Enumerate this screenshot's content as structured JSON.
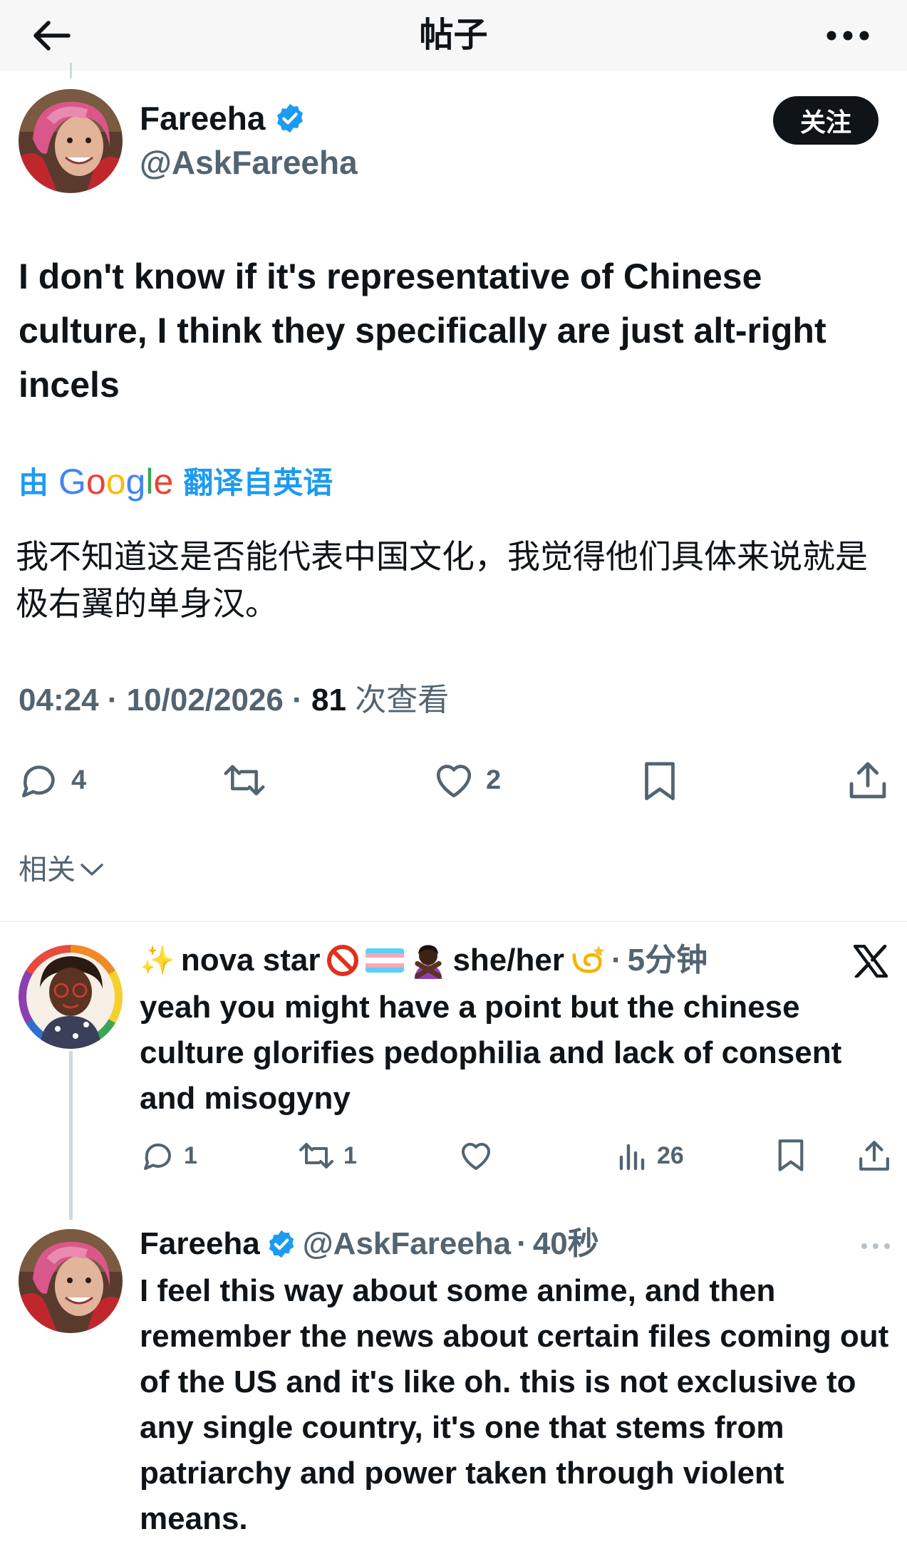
{
  "header": {
    "title": "帖子",
    "back_icon": "arrow-left-icon",
    "more_icon": "more-horizontal-icon"
  },
  "post": {
    "author_name": "Fareeha",
    "handle": "@AskFareeha",
    "follow_label": "关注",
    "text": "I don't know if it's representative of Chinese culture, I think they specifically are just alt-right incels",
    "translate_prefix": "由",
    "translate_brand": "Google",
    "translate_suffix": "翻译自英语",
    "translated_text": "我不知道这是否能代表中国文化，我觉得他们具体来说就是极右翼的单身汉。",
    "time": "04:24",
    "date": "10/02/2026",
    "views_count": "81",
    "views_label": "次查看",
    "separator": "·",
    "stats": {
      "replies": "4",
      "retweets": "",
      "likes": "2"
    }
  },
  "related_label": "相关",
  "replies": [
    {
      "author_name": "nova star",
      "pronouns": "she/her",
      "time": "5分钟",
      "text": "yeah you might have a point but the chinese culture glorifies pedophilia and lack of consent and misogyny",
      "stats": {
        "replies": "1",
        "retweets": "1",
        "likes": "",
        "views": "26"
      }
    },
    {
      "author_name": "Fareeha",
      "handle": "@AskFareeha",
      "time": "40秒",
      "text": "I feel this way about some anime, and then remember the news about certain files coming out of the US and it's like oh. this is not exclusive to any single country, it's one that stems from patriarchy and power taken through violent means."
    }
  ],
  "colors": {
    "text": "#0f1419",
    "secondary": "#536471",
    "accent": "#1d9bf0",
    "verified": "#1d9bf0",
    "button_bg": "#0f1419"
  }
}
